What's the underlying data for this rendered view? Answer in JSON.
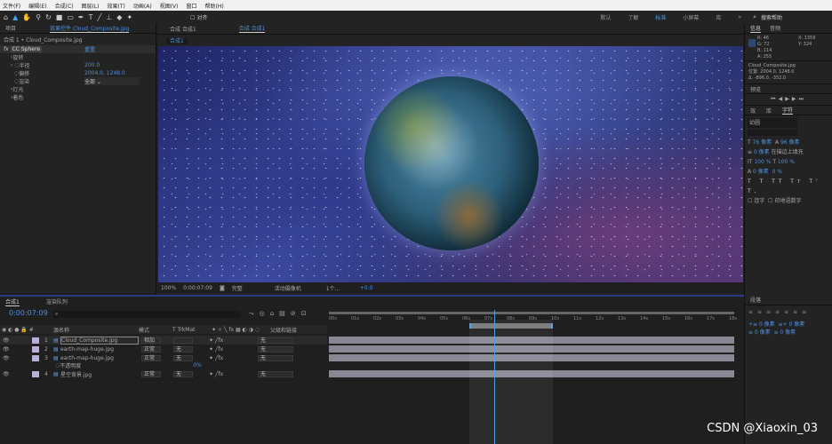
{
  "menu": [
    "文件(F)",
    "编辑(E)",
    "合成(C)",
    "图层(L)",
    "效果(T)",
    "动画(A)",
    "视图(V)",
    "窗口",
    "帮助(H)"
  ],
  "toolbar": {
    "snap": "对齐",
    "workspaces": [
      "默认",
      "了解",
      "标准",
      "小屏幕",
      "库"
    ],
    "active_workspace": "标准",
    "search": "搜索帮助"
  },
  "effects_panel": {
    "project_tab": "项目",
    "tab": "效果控件 Cloud_Composite.jpg",
    "breadcrumb": "合成 1 • Cloud_Composite.jpg",
    "effect": "CC Sphere",
    "reset": "重置",
    "props": [
      {
        "label": "旋转",
        "value": ""
      },
      {
        "label": "半径",
        "value": "200.0"
      },
      {
        "label": "偏移",
        "value": "2004.0, 1248.0"
      },
      {
        "label": "渲染",
        "value": "全部"
      },
      {
        "label": "灯光",
        "value": ""
      },
      {
        "label": "着色",
        "value": ""
      }
    ]
  },
  "viewer": {
    "tab1": "合成 合成1",
    "tab2": "合成 合成1",
    "sub_tab": "合成1",
    "zoom": "100%",
    "timecode": "0:00:07:09",
    "resolution": "完整",
    "camera": "活动摄像机",
    "views": "1个...",
    "exposure": "+0.0"
  },
  "info": {
    "tab": "信息",
    "tab2": "音频",
    "r": "R: 46",
    "g": "G: 72",
    "b": "B: 114",
    "a": "A: 255",
    "x": "X: 1359",
    "y": "Y: 324",
    "file": "Cloud_Composite.jpg",
    "position": "位置: 2004.0, 1248.0",
    "delta": "Δ: -896.0, -352.0",
    "swatch": "#2e4872"
  },
  "preview": {
    "title": "预览"
  },
  "character": {
    "tabs": [
      "效",
      "库",
      "字符"
    ],
    "font": "幼圆",
    "size": "76 像素",
    "leading": "96 像素",
    "stroke": "0 像素",
    "stroke_mode": "在描边上填充",
    "vscale": "100 %",
    "hscale": "100 %",
    "baseline": "0 像素",
    "tsume": "0 %",
    "ligature": "连字",
    "hindi": "印地语数字"
  },
  "paragraph": {
    "title": "段落"
  },
  "timeline": {
    "tab": "合成1",
    "render_tab": "渲染队列",
    "timecode": "0:00:07:09",
    "headers": {
      "name": "源名称",
      "mode": "模式",
      "trkmat": "T TrkMat",
      "parent": "父级和链接"
    },
    "layers": [
      {
        "num": "1",
        "name": "Cloud_Composite.jpg",
        "mode": "相加",
        "trk": "",
        "parent": "无"
      },
      {
        "num": "2",
        "name": "earth-map-huge.jpg",
        "mode": "正常",
        "trk": "无",
        "parent": "无"
      },
      {
        "num": "3",
        "name": "earth-map-huge.jpg",
        "mode": "正常",
        "trk": "无",
        "parent": "无"
      },
      {
        "num": "4",
        "name": "星空背景.jpg",
        "mode": "正常",
        "trk": "无",
        "parent": "无"
      }
    ],
    "opacity_label": "不透明度",
    "opacity_value": "0%",
    "ticks": [
      "00s",
      "01s",
      "02s",
      "03s",
      "04s",
      "05s",
      "06s",
      "07s",
      "08s",
      "09s",
      "10s",
      "11s",
      "12s",
      "13s",
      "14s",
      "15s",
      "16s",
      "17s",
      "18s"
    ]
  },
  "watermark": "CSDN @Xiaoxin_03"
}
